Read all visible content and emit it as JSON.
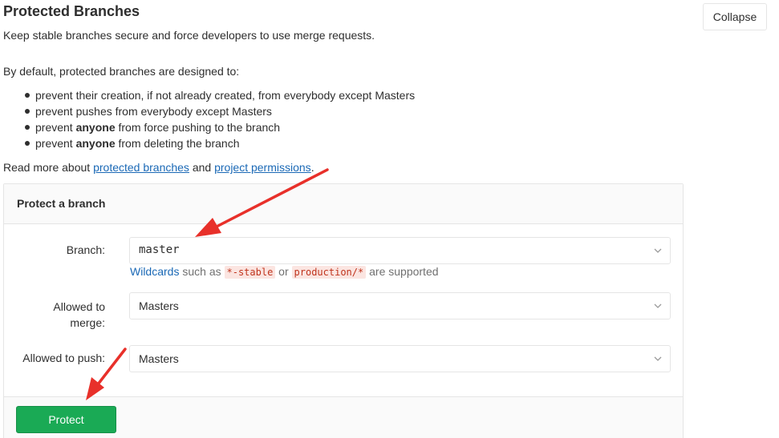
{
  "header": {
    "title": "Protected Branches",
    "subtitle": "Keep stable branches secure and force developers to use merge requests.",
    "collapse_label": "Collapse"
  },
  "intro": "By default, protected branches are designed to:",
  "rules": [
    {
      "before": "prevent their creation, if not already created, from everybody except Masters",
      "bold": "",
      "after": ""
    },
    {
      "before": "prevent pushes from everybody except Masters",
      "bold": "",
      "after": ""
    },
    {
      "before": "prevent ",
      "bold": "anyone",
      "after": " from force pushing to the branch"
    },
    {
      "before": "prevent ",
      "bold": "anyone",
      "after": " from deleting the branch"
    }
  ],
  "readmore": {
    "prefix": "Read more about ",
    "link1": "protected branches",
    "middle": " and ",
    "link2": "project permissions",
    "suffix": "."
  },
  "panel": {
    "title": "Protect a branch",
    "branch": {
      "label": "Branch:",
      "value": "master",
      "hint_link": "Wildcards",
      "hint_such_as": " such as ",
      "hint_code1": "*-stable",
      "hint_or": " or ",
      "hint_code2": "production/*",
      "hint_suffix": " are supported"
    },
    "merge": {
      "label_line1": "Allowed to",
      "label_line2": "merge:",
      "value": "Masters"
    },
    "push": {
      "label": "Allowed to push:",
      "value": "Masters"
    },
    "protect_label": "Protect"
  },
  "colors": {
    "protect_button": "#1aaa55",
    "link": "#1b69b6",
    "annotation_arrow": "#e8302a"
  },
  "icons": {
    "select_chevron": "chevron-down-icon"
  }
}
